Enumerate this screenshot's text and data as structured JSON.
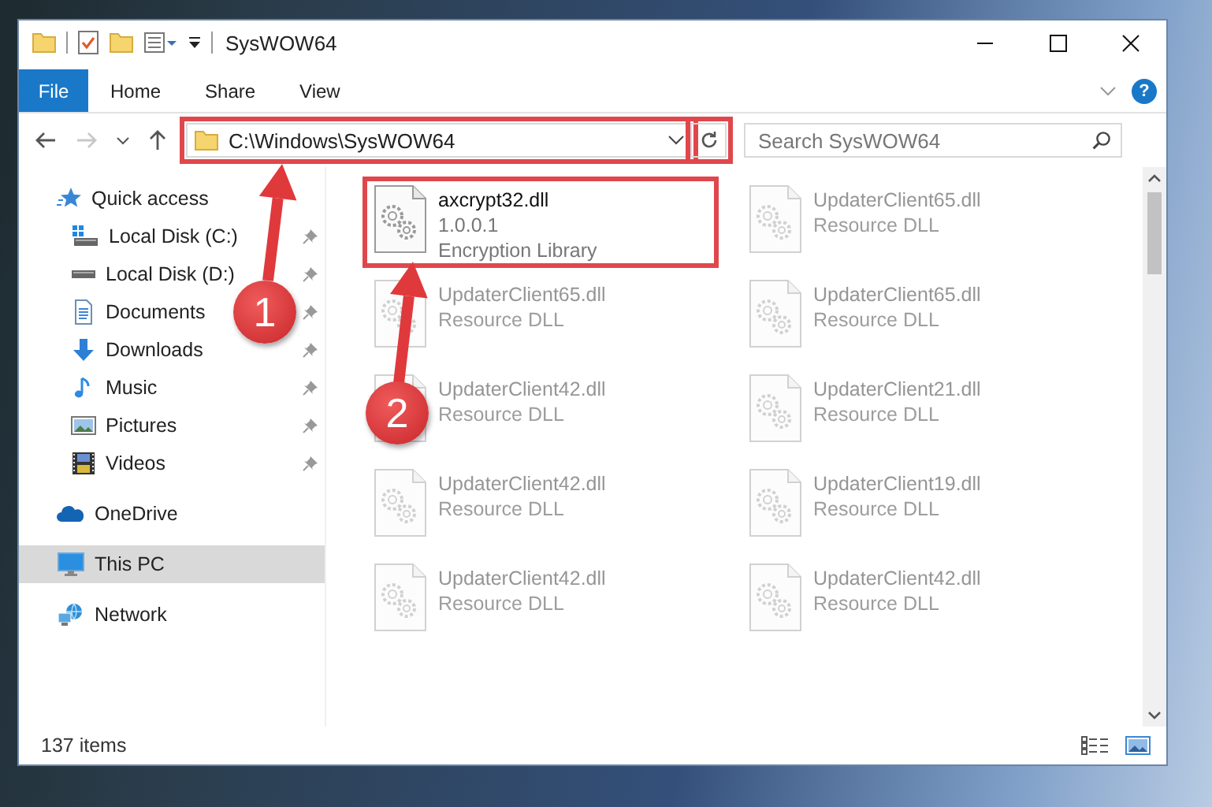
{
  "window": {
    "title": "SysWOW64"
  },
  "ribbon": {
    "tabs": [
      {
        "label": "File",
        "kind": "file"
      },
      {
        "label": "Home",
        "kind": "tab"
      },
      {
        "label": "Share",
        "kind": "tab"
      },
      {
        "label": "View",
        "kind": "tab"
      }
    ],
    "help": "?"
  },
  "address": {
    "path": "C:\\Windows\\SysWOW64",
    "highlighted": true
  },
  "search": {
    "placeholder": "Search SysWOW64"
  },
  "navigation": [
    {
      "label": "Quick access",
      "selected": false,
      "children": [
        {
          "label": "Local Disk (C:)",
          "pinned": true,
          "selected": false
        },
        {
          "label": "Local Disk (D:)",
          "pinned": true,
          "selected": false
        },
        {
          "label": "Documents",
          "pinned": true,
          "selected": false
        },
        {
          "label": "Downloads",
          "pinned": true,
          "selected": false
        },
        {
          "label": "Music",
          "pinned": true,
          "selected": false
        },
        {
          "label": "Pictures",
          "pinned": true,
          "selected": false
        },
        {
          "label": "Videos",
          "pinned": true,
          "selected": false
        }
      ]
    },
    {
      "label": "OneDrive",
      "selected": false
    },
    {
      "label": "This PC",
      "selected": true
    },
    {
      "label": "Network",
      "selected": false
    }
  ],
  "files": [
    {
      "name": "axcrypt32.dll",
      "details": [
        "1.0.0.1",
        "Encryption Library"
      ],
      "highlighted": true,
      "dimmed": false
    },
    {
      "name": "UpdaterClient65.dll",
      "details": [
        "Resource DLL"
      ],
      "highlighted": false,
      "dimmed": true
    },
    {
      "name": "UpdaterClient65.dll",
      "details": [
        "Resource DLL"
      ],
      "highlighted": false,
      "dimmed": true
    },
    {
      "name": "UpdaterClient65.dll",
      "details": [
        "Resource DLL"
      ],
      "highlighted": false,
      "dimmed": true
    },
    {
      "name": "UpdaterClient42.dll",
      "details": [
        "Resource DLL"
      ],
      "highlighted": false,
      "dimmed": true
    },
    {
      "name": "UpdaterClient21.dll",
      "details": [
        "Resource DLL"
      ],
      "highlighted": false,
      "dimmed": true
    },
    {
      "name": "UpdaterClient42.dll",
      "details": [
        "Resource DLL"
      ],
      "highlighted": false,
      "dimmed": true
    },
    {
      "name": "UpdaterClient19.dll",
      "details": [
        "Resource DLL"
      ],
      "highlighted": false,
      "dimmed": true
    },
    {
      "name": "UpdaterClient42.dll",
      "details": [
        "Resource DLL"
      ],
      "highlighted": false,
      "dimmed": true
    },
    {
      "name": "UpdaterClient42.dll",
      "details": [
        "Resource DLL"
      ],
      "highlighted": false,
      "dimmed": true
    }
  ],
  "status_bar": {
    "item_count": "137 items"
  },
  "callouts": [
    {
      "number": "1"
    },
    {
      "number": "2"
    }
  ]
}
